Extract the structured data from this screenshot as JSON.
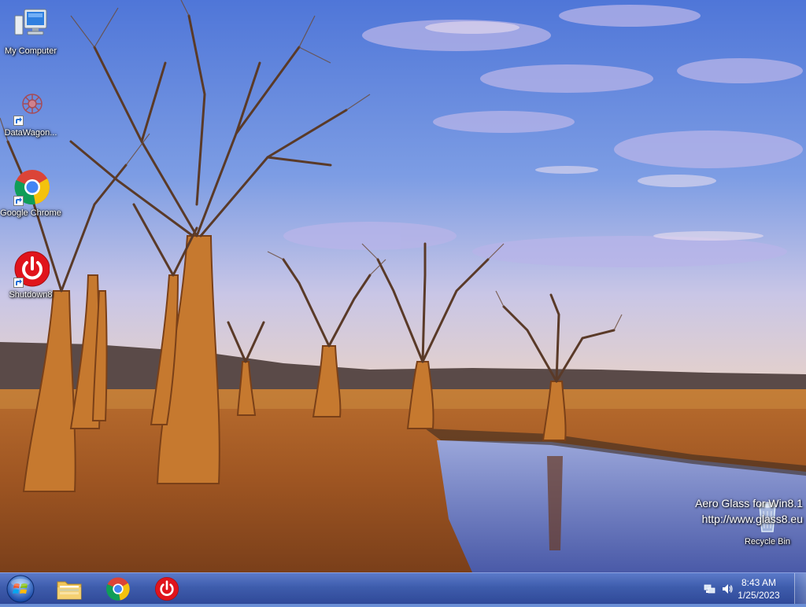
{
  "desktop": {
    "icons": [
      {
        "label": "My Computer",
        "icon": "computer-icon"
      },
      {
        "label": "DataWagon...",
        "icon": "datawagon-icon"
      },
      {
        "label": "Google Chrome",
        "icon": "chrome-icon"
      },
      {
        "label": "Shutdown8",
        "icon": "power-icon"
      },
      {
        "label": "Recycle Bin",
        "icon": "recycle-bin-icon"
      }
    ],
    "watermark": {
      "line1": "Aero Glass for Win8.1",
      "line2": "http://www.glass8.eu"
    }
  },
  "taskbar": {
    "start": {
      "icon": "windows-start-orb-icon"
    },
    "pinned": [
      {
        "icon": "file-explorer-icon"
      },
      {
        "icon": "chrome-icon"
      },
      {
        "icon": "power-icon"
      }
    ],
    "tray": {
      "icons": [
        "network-icon",
        "volume-icon"
      ],
      "time": "8:43 AM",
      "date": "1/25/2023"
    }
  },
  "colors": {
    "taskbar": "#3c5aa8",
    "sky": "#6b8fd6",
    "ground": "#b5652a",
    "power_red": "#e0141c"
  }
}
